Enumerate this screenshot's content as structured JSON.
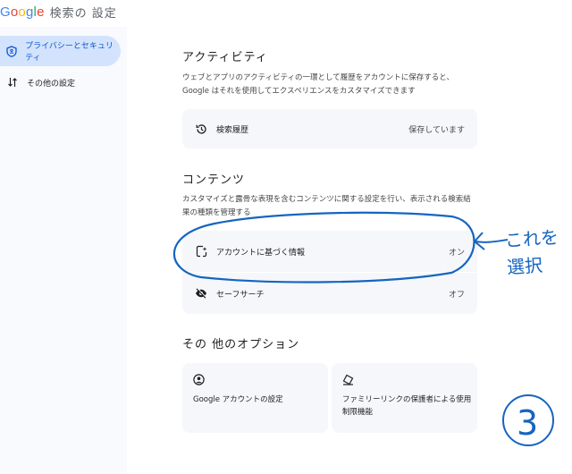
{
  "header": {
    "logo": "Google",
    "title": "検索の 設定"
  },
  "sidebar": {
    "items": [
      {
        "label": "プライバシーとセキュリティ",
        "icon": "shield-icon"
      },
      {
        "label": "その他の設定",
        "icon": "sort-arrows-icon"
      }
    ]
  },
  "activity": {
    "heading": "アクティビティ",
    "description": "ウェブとアプリのアクティビティの一環として履歴をアカウントに保存すると、Google はそれを使用してエクスペリエンスをカスタマイズできます",
    "history": {
      "label": "検索履歴",
      "value": "保存しています",
      "icon": "history-icon"
    }
  },
  "content": {
    "heading": "コンテンツ",
    "description": "カスタマイズと露骨な表現を含むコンテンツに関する設定を行い、表示される検索結果の種類を管理する",
    "rows": [
      {
        "label": "アカウントに基づく情報",
        "value": "オン",
        "icon": "sparkle-personal-icon"
      },
      {
        "label": "セーフサーチ",
        "value": "オフ",
        "icon": "eye-off-icon"
      }
    ]
  },
  "options": {
    "heading": "その 他のオプション",
    "cards": [
      {
        "label": "Google アカウントの設定",
        "icon": "account-circle-icon"
      },
      {
        "label": "ファミリーリンクの保護者による使用制限機能",
        "icon": "family-link-icon"
      }
    ]
  },
  "annotation": {
    "note": "これを選択",
    "number": "3",
    "color": "#1565c0"
  },
  "colors": {
    "accent": "#0b57d0",
    "sidebar_active": "#d3e3fd",
    "card_bg": "#f5f7fb"
  }
}
